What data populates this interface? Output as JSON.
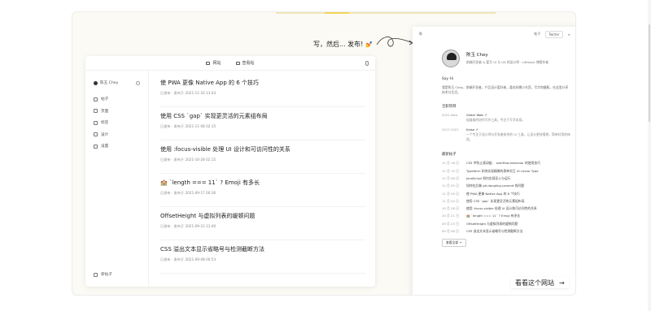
{
  "callout": {
    "text": "写，然后... 发布!",
    "emoji": "💅"
  },
  "editor": {
    "tabs": [
      "网站",
      "查看帖"
    ],
    "sidebar": {
      "user": "陈玉 Chey",
      "items": [
        "帖子",
        "页面",
        "标签",
        "设计",
        "设置"
      ],
      "new_post": "新帖子"
    },
    "posts": [
      {
        "title": "使 PWA 更像 Native App 的 6 个技巧",
        "meta": "已发布 · 发布于 2021-11-16 13:43"
      },
      {
        "title": "使用 CSS `gap` 实现更灵活的元素组布局",
        "meta": "已发布 · 发布于 2021-11-08 02:15"
      },
      {
        "title": "使用 :focus-visible 处理 UI 设计和可访问性的关系",
        "meta": "已发布 · 发布于 2021-10-28 02:15"
      },
      {
        "title": "🏫 `length === 11` ? Emoji 有多长",
        "meta": "已发布 · 发布于 2021-09-17 00:36"
      },
      {
        "title": "OffsetHeight 与虚拟列表的缓顿问题",
        "meta": "已发布 · 发布于 2021-09-23 13:40"
      },
      {
        "title": "CSS 溢出文本显示省略号与检测截断方法",
        "meta": "已发布 · 发布于 2021-09-08 00:53"
      }
    ]
  },
  "preview": {
    "site": "陈",
    "top_right": [
      "帖子",
      "Twitter"
    ],
    "name": "陈玉 Chey",
    "bio": "前端开发者 & 爱写 UI 与 UX 的设计师 · Lifestyle 博客作者",
    "say_hi_heading": "Say Hi",
    "say_hi_text": "我是陈玉 Chey，前端开发者，产品设计爱好者，喜欢折腾小东西，写字和摄影。在这里分享技术与生活。",
    "work_heading": "全职项目",
    "work": [
      {
        "date": "2021-Now",
        "title": "Glider Web ↗",
        "desc": "轻量级的协作写作工具，专注于写字本身。"
      },
      {
        "date": "2017-2021",
        "title": "Eaise ↗",
        "desc": "一个专注于设计师与开发者协作的 UI 工具，让设计更快落地，简单好用的体验。"
      }
    ],
    "recent_heading": "最新帖子",
    "recent": [
      {
        "date": "11 月 16 日",
        "title": "CSS 中防止滚动链： overflow-behavior 的使用技巧"
      },
      {
        "date": "11 月 10 日",
        "title": "Typeform 如何实现精美的表单交互 UI Linear Type"
      },
      {
        "date": "11 月 08 日",
        "title": "JavaScript 如何实现导入与运行"
      },
      {
        "date": "11 月 05 日",
        "title": "如何在后端 git.dangling.commit 的问题"
      },
      {
        "date": "11 月 05 日",
        "title": "使 PWA 更像 Native App 的 6 个技巧"
      },
      {
        "date": "11 月 04 日",
        "title": "使用 CSS `gap` 实现更灵活的元素组布局"
      },
      {
        "date": "10 月 28 日",
        "title": "使用 :focus-visible 处理 UI 设计和可访问性的关系"
      },
      {
        "date": "10 月 21 日",
        "title": "🏫 `length === 11` ? Emoji 有多长"
      },
      {
        "date": "09 月 23 日",
        "title": "OffsetHeight 与虚拟列表的缓顿问题"
      },
      {
        "date": "09 月 08 日",
        "title": "CSS 溢出文本显示省略号与检测截断方法"
      }
    ],
    "more": "查看全部 →"
  },
  "cta": {
    "label": "看看这个网站",
    "arrow": "→"
  }
}
